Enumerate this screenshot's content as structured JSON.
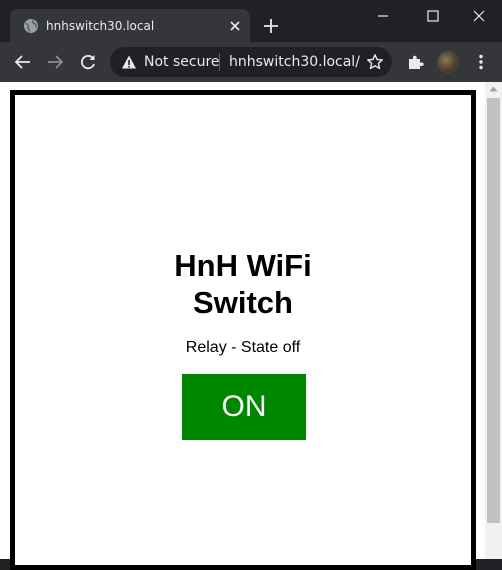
{
  "browser": {
    "tab": {
      "title": "hnhswitch30.local"
    },
    "omnibox": {
      "security_label": "Not secure",
      "url": "hnhswitch30.local/"
    }
  },
  "page": {
    "heading_line1": "HnH WiFi",
    "heading_line2": "Switch",
    "state_text": "Relay - State off",
    "button_label": "ON"
  },
  "colors": {
    "button_bg": "#008700",
    "frame_border": "#000000",
    "browser_dark": "#202124",
    "toolbar": "#35363a"
  }
}
